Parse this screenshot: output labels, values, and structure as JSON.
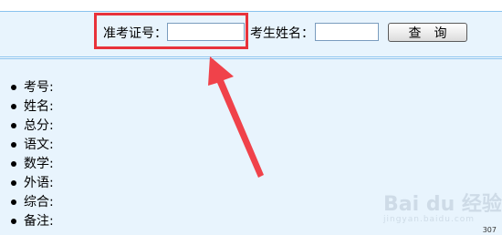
{
  "form": {
    "ticket_label": "准考证号：",
    "ticket_value": "",
    "name_label": "考生姓名：",
    "name_value": "",
    "search_button": "查询"
  },
  "results": {
    "fields": [
      "考号:",
      "姓名:",
      "总分:",
      "语文:",
      "数学:",
      "外语:",
      "综合:",
      "备注:"
    ]
  },
  "watermark": {
    "text": "Bai du 经验",
    "sub": "jingyan.baidu.com"
  },
  "corner_text": "307",
  "colors": {
    "panel_bg": "#e8f4fd",
    "border": "#89c2ee",
    "highlight": "#e8323a"
  }
}
